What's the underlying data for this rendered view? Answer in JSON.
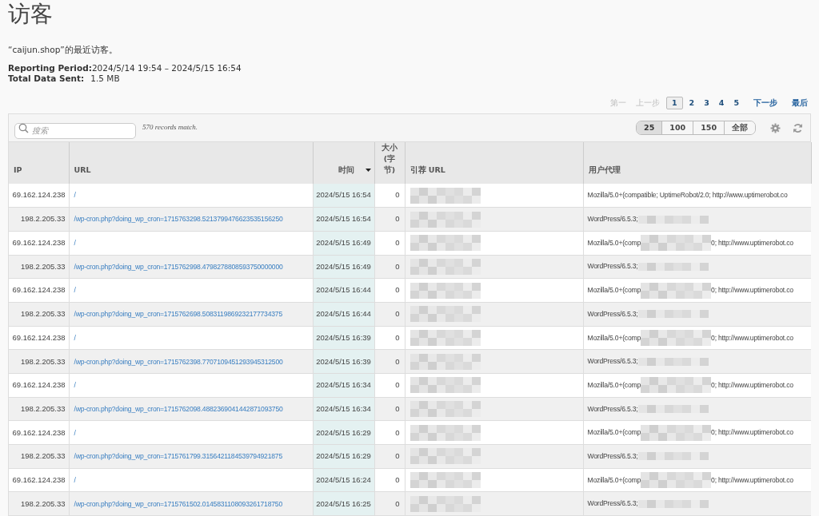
{
  "title": "访客",
  "subtitle": "“caijun.shop”的最近访客。",
  "period": {
    "label": "Reporting Period:",
    "value": "2024/5/14 19:54 – 2024/5/15 16:54"
  },
  "total": {
    "label": "Total Data Sent:",
    "value": "1.5 MB"
  },
  "pagination": [
    {
      "label": "第一",
      "kind": "nav",
      "disabled": true,
      "selected": false
    },
    {
      "label": "上一步",
      "kind": "nav",
      "disabled": true,
      "selected": false
    },
    {
      "label": "1",
      "kind": "page",
      "disabled": false,
      "selected": true
    },
    {
      "label": "2",
      "kind": "page",
      "disabled": false,
      "selected": false
    },
    {
      "label": "3",
      "kind": "page",
      "disabled": false,
      "selected": false
    },
    {
      "label": "4",
      "kind": "page",
      "disabled": false,
      "selected": false
    },
    {
      "label": "5",
      "kind": "page",
      "disabled": false,
      "selected": false
    },
    {
      "label": "下一步",
      "kind": "nav",
      "disabled": false,
      "selected": false
    },
    {
      "label": "最后",
      "kind": "nav",
      "disabled": false,
      "selected": false
    }
  ],
  "search": {
    "placeholder": "搜索"
  },
  "match_count": "570 records match.",
  "page_sizes": [
    {
      "label": "25",
      "selected": true
    },
    {
      "label": "100",
      "selected": false
    },
    {
      "label": "150",
      "selected": false
    },
    {
      "label": "全部",
      "selected": false
    }
  ],
  "table": {
    "columns": [
      {
        "label": "IP",
        "sorted": false
      },
      {
        "label": "URL",
        "sorted": false
      },
      {
        "label": "时间",
        "sorted": true
      },
      {
        "label": "大小\n(字节)",
        "sorted": false
      },
      {
        "label": "引荐 URL",
        "sorted": false
      },
      {
        "label": "用户代理",
        "sorted": false
      }
    ],
    "rows": [
      {
        "ip": "69.162.124.238",
        "url": "/",
        "time": "2024/5/15 16:54",
        "size": "0",
        "referrer_redacted": true,
        "ua": "Mozilla/5.0+(compatible; UptimeRobot/2.0; http://www.uptimerobot.co",
        "ua_redacted": false
      },
      {
        "ip": "198.2.205.33",
        "url": "/wp-cron.php?doing_wp_cron=1715763298.5213799476623535156250",
        "time": "2024/5/15 16:54",
        "size": "0",
        "referrer_redacted": true,
        "ua": "WordPress/6.5.3;",
        "ua_redacted": true
      },
      {
        "ip": "69.162.124.238",
        "url": "/",
        "time": "2024/5/15 16:49",
        "size": "0",
        "referrer_redacted": true,
        "ua": "Mozilla/5.0+(comp",
        "ua_redacted": true,
        "ua_tail": "0; http://www.uptimerobot.co"
      },
      {
        "ip": "198.2.205.33",
        "url": "/wp-cron.php?doing_wp_cron=1715762998.4798278808593750000000",
        "time": "2024/5/15 16:49",
        "size": "0",
        "referrer_redacted": true,
        "ua": "WordPress/6.5.3;",
        "ua_redacted": true
      },
      {
        "ip": "69.162.124.238",
        "url": "/",
        "time": "2024/5/15 16:44",
        "size": "0",
        "referrer_redacted": true,
        "ua": "Mozilla/5.0+(comp",
        "ua_redacted": true,
        "ua_tail": "0; http://www.uptimerobot.co"
      },
      {
        "ip": "198.2.205.33",
        "url": "/wp-cron.php?doing_wp_cron=1715762698.5083119869232177734375",
        "time": "2024/5/15 16:44",
        "size": "0",
        "referrer_redacted": true,
        "ua": "WordPress/6.5.3;",
        "ua_redacted": true
      },
      {
        "ip": "69.162.124.238",
        "url": "/",
        "time": "2024/5/15 16:39",
        "size": "0",
        "referrer_redacted": true,
        "ua": "Mozilla/5.0+(comp",
        "ua_redacted": true,
        "ua_tail": "0; http://www.uptimerobot.co"
      },
      {
        "ip": "198.2.205.33",
        "url": "/wp-cron.php?doing_wp_cron=1715762398.7707109451293945312500",
        "time": "2024/5/15 16:39",
        "size": "0",
        "referrer_redacted": true,
        "ua": "WordPress/6.5.3;",
        "ua_redacted": true
      },
      {
        "ip": "69.162.124.238",
        "url": "/",
        "time": "2024/5/15 16:34",
        "size": "0",
        "referrer_redacted": true,
        "ua": "Mozilla/5.0+(comp",
        "ua_redacted": true,
        "ua_tail": "0; http://www.uptimerobot.co"
      },
      {
        "ip": "198.2.205.33",
        "url": "/wp-cron.php?doing_wp_cron=1715762098.4882369041442871093750",
        "time": "2024/5/15 16:34",
        "size": "0",
        "referrer_redacted": true,
        "ua": "WordPress/6.5.3;",
        "ua_redacted": true
      },
      {
        "ip": "69.162.124.238",
        "url": "/",
        "time": "2024/5/15 16:29",
        "size": "0",
        "referrer_redacted": true,
        "ua": "Mozilla/5.0+(comp",
        "ua_redacted": true,
        "ua_tail": "0; http://www.uptimerobot.co"
      },
      {
        "ip": "198.2.205.33",
        "url": "/wp-cron.php?doing_wp_cron=1715761799.3156421184539794921875",
        "time": "2024/5/15 16:29",
        "size": "0",
        "referrer_redacted": true,
        "ua": "WordPress/6.5.3;",
        "ua_redacted": true
      },
      {
        "ip": "69.162.124.238",
        "url": "/",
        "time": "2024/5/15 16:24",
        "size": "0",
        "referrer_redacted": true,
        "ua": "Mozilla/5.0+(comp",
        "ua_redacted": true,
        "ua_tail": "0; http://www.uptimerobot.co"
      },
      {
        "ip": "198.2.205.33",
        "url": "/wp-cron.php?doing_wp_cron=1715761502.0145831108093261718750",
        "time": "2024/5/15 16:25",
        "size": "0",
        "referrer_redacted": true,
        "ua": "WordPress/6.5.3;",
        "ua_redacted": true
      }
    ]
  }
}
